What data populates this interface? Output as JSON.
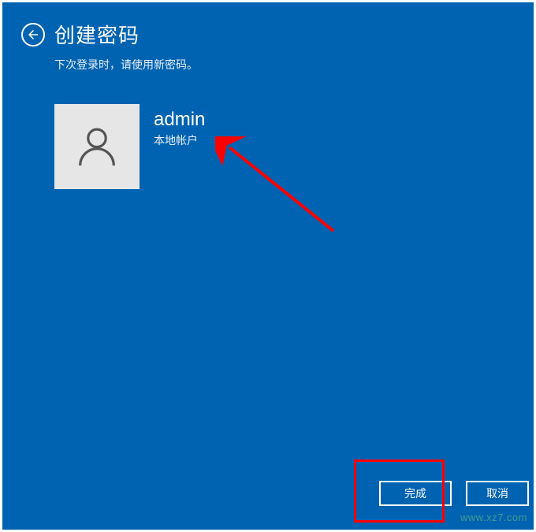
{
  "header": {
    "title": "创建密码",
    "subtitle": "下次登录时，请使用新密码。"
  },
  "account": {
    "name": "admin",
    "type": "本地帐户"
  },
  "buttons": {
    "finish": "完成",
    "cancel": "取消"
  },
  "watermark": "www.xz7.com"
}
